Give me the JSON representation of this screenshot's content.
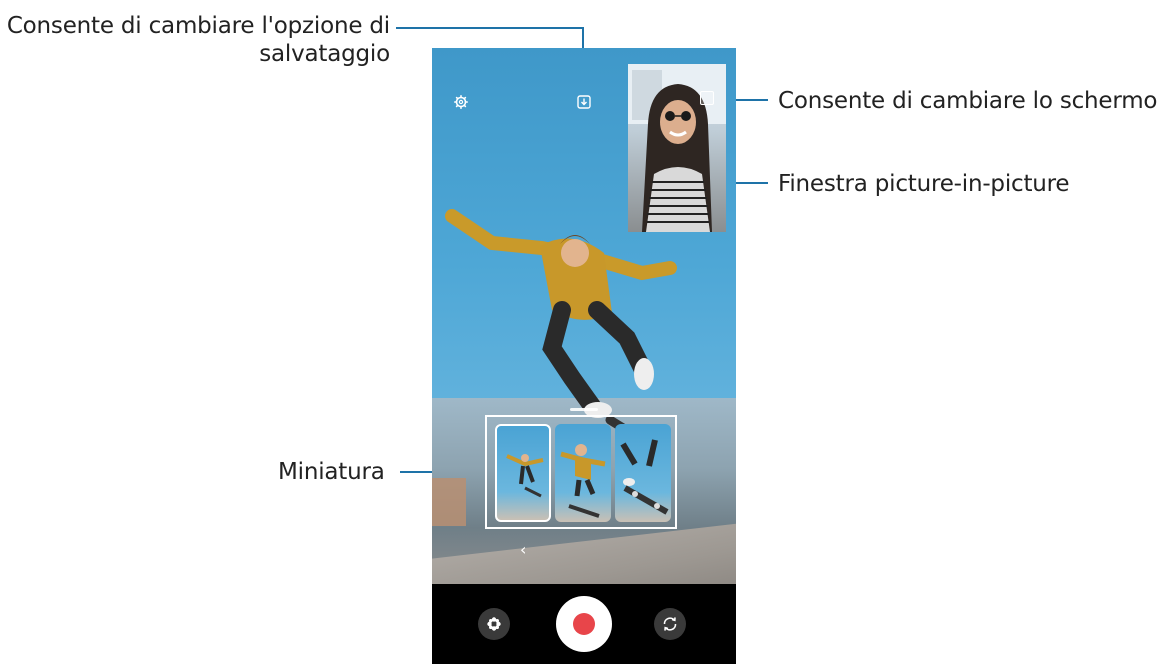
{
  "callouts": {
    "save_option": "Consente di cambiare l'opzione di\nsalvataggio",
    "switch_screen": "Consente di cambiare lo schermo",
    "pip_window": "Finestra picture-in-picture",
    "thumbnail": "Miniatura"
  },
  "camera": {
    "settings_icon": "gear-icon",
    "save_option_icon": "download-icon",
    "switch_screen_icon": "pip-switch-icon",
    "back_icon": "chevron-left-icon",
    "effects_icon": "effects-icon",
    "flip_icon": "camera-flip-icon",
    "record_icon": "record-icon",
    "back_glyph": "‹"
  },
  "colors": {
    "callout_line": "#1e73a8",
    "record": "#e8454a",
    "control_bar": "#000000"
  }
}
